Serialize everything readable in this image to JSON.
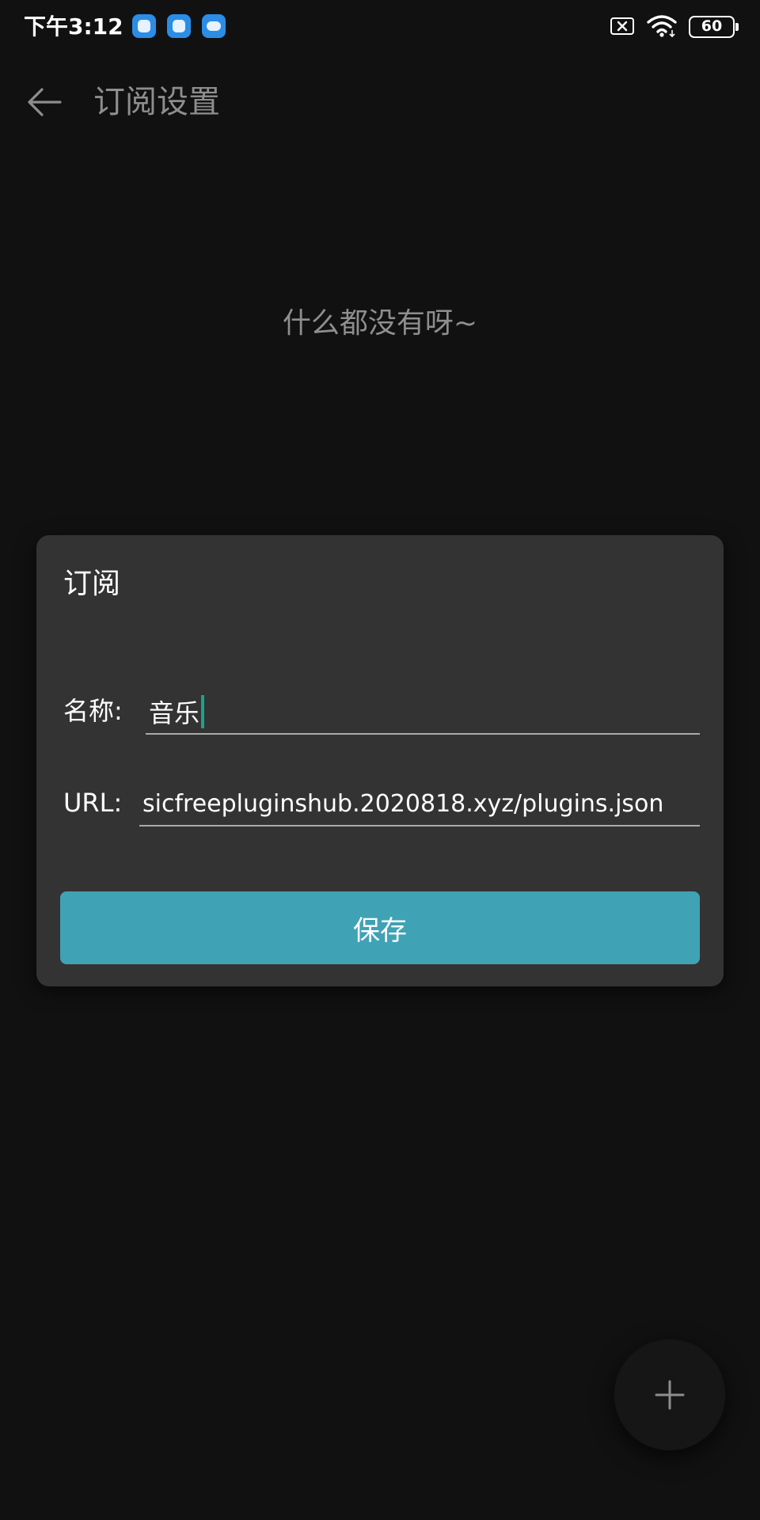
{
  "status_bar": {
    "time": "下午3:12",
    "battery": "60",
    "icons": [
      "app-notification-icon",
      "app-notification-icon",
      "cloud-notification-icon",
      "no-sim-icon",
      "wifi-icon",
      "battery-icon"
    ]
  },
  "app_bar": {
    "back_icon": "arrow-left-icon",
    "title": "订阅设置"
  },
  "empty_state": {
    "text": "什么都没有呀~"
  },
  "dialog": {
    "title": "订阅",
    "name_label": "名称:",
    "name_value": "音乐",
    "url_label": "URL:",
    "url_value": "sicfreepluginshub.2020818.xyz/plugins.json",
    "save_label": "保存"
  },
  "fab": {
    "icon": "plus-icon"
  },
  "colors": {
    "background": "#111111",
    "dialog": "#333333",
    "accent": "#40a2b5",
    "caret": "#1aa28f",
    "muted_text": "#8e8e8e"
  }
}
